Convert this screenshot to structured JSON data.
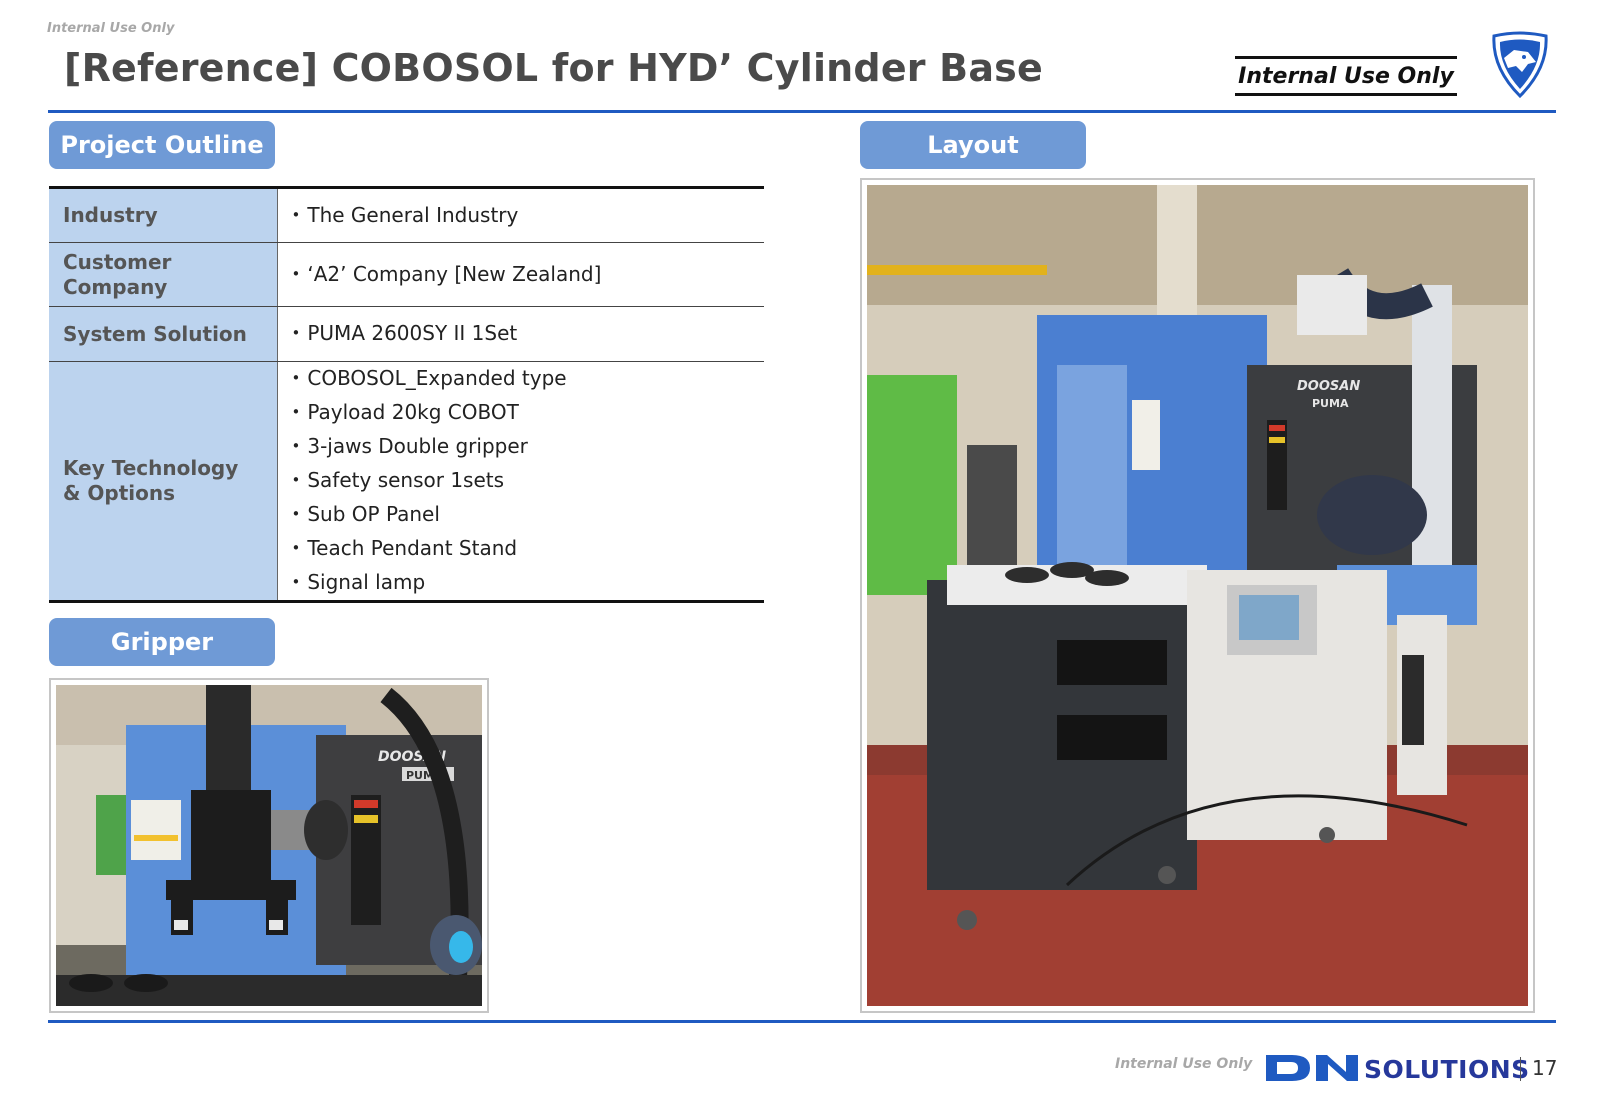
{
  "header": {
    "watermark": "Internal Use Only",
    "title": "[Reference] COBOSOL for HYD’ Cylinder Base",
    "badge": "Internal Use Only",
    "logo_icon": "panther-shield-icon"
  },
  "sections": {
    "outline": "Project Outline",
    "layout": "Layout",
    "gripper": "Gripper"
  },
  "outline_table": [
    {
      "label": "Industry",
      "values": [
        "The General Industry"
      ]
    },
    {
      "label": "Customer Company",
      "values": [
        "‘A2’ Company [New Zealand]"
      ]
    },
    {
      "label": "System Solution",
      "values": [
        "PUMA 2600SY II 1Set"
      ]
    },
    {
      "label": "Key Technology & Options",
      "values": [
        "COBOSOL_Expanded type",
        "Payload 20kg COBOT",
        "3-jaws Double gripper",
        "Safety sensor 1sets",
        "Sub OP Panel",
        "Teach Pendant Stand",
        "Signal lamp"
      ]
    }
  ],
  "images": {
    "gripper_photo_text": [
      "DOOSAN",
      "PUMA"
    ],
    "layout_photo_text": [
      "DOOSAN",
      "PUMA"
    ]
  },
  "footer": {
    "watermark": "Internal Use Only",
    "brand": "SOLUTIONS",
    "page_number": "17"
  },
  "colors": {
    "accent_blue": "#1f5ac1",
    "tab_blue": "#6f9ad6",
    "label_fill": "#bcd3ee",
    "brand_navy": "#26389b"
  }
}
